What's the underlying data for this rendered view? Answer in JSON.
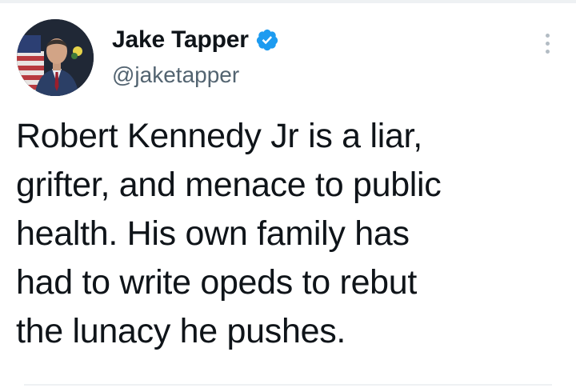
{
  "tweet": {
    "author": {
      "display_name": "Jake Tapper",
      "handle": "@jaketapper",
      "verified": true,
      "verified_icon": "verified-badge-icon",
      "avatar": "profile-photo"
    },
    "text": "Robert Kennedy Jr is a liar,\ngrifter, and menace to public\nhealth. His own family has\nhad to write opeds to rebut\nthe lunacy he pushes.",
    "more_icon": "more-options-icon"
  },
  "colors": {
    "verified_blue": "#1d9bf0",
    "text_primary": "#0f1419",
    "text_secondary": "#536471"
  }
}
